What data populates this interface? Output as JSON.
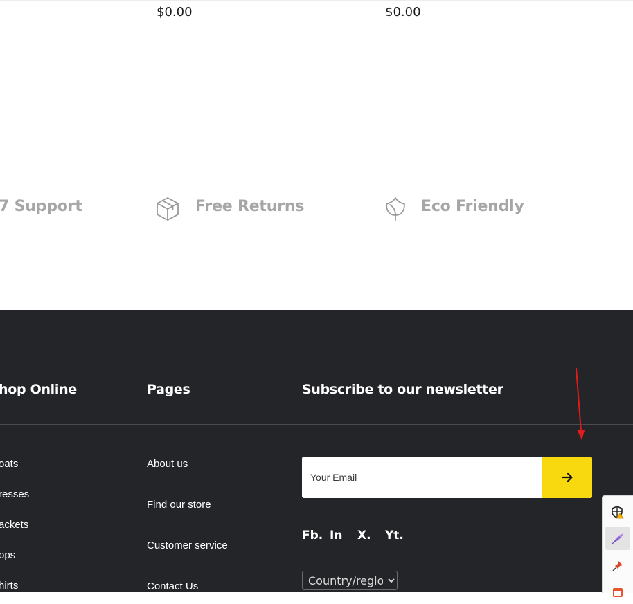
{
  "products": [
    {
      "price": "$0.00"
    },
    {
      "price": "$0.00"
    }
  ],
  "features": [
    {
      "label": "7 Support",
      "icon": "support-icon"
    },
    {
      "label": "Free Returns",
      "icon": "box-icon"
    },
    {
      "label": "Eco Friendly",
      "icon": "leaf-icon"
    }
  ],
  "footer": {
    "columns": {
      "shop": {
        "title": "hop Online",
        "links": [
          "oats",
          "resses",
          "ackets",
          "ops",
          "hirts"
        ]
      },
      "pages": {
        "title": "Pages",
        "links": [
          "About us",
          "Find our store",
          "Customer service",
          "Contact Us"
        ]
      },
      "newsletter": {
        "title": "Subscribe to our newsletter"
      }
    },
    "email_placeholder": "Your Email",
    "submit_icon": "arrow-right-icon",
    "social": [
      "Fb.",
      "In",
      "X.",
      "Yt."
    ],
    "country_select": {
      "selected": "Country/region",
      "options": [
        "Country/region"
      ]
    }
  },
  "colors": {
    "footer_bg": "#242529",
    "accent_yellow": "#f8d90f",
    "feature_gray": "#a6a6a6",
    "annotation_red": "#e11b1b"
  },
  "extension_tray": {
    "icons": [
      "shield-warning-icon",
      "feather-icon",
      "pin-icon",
      "calendar-icon"
    ],
    "active_index": 1
  }
}
